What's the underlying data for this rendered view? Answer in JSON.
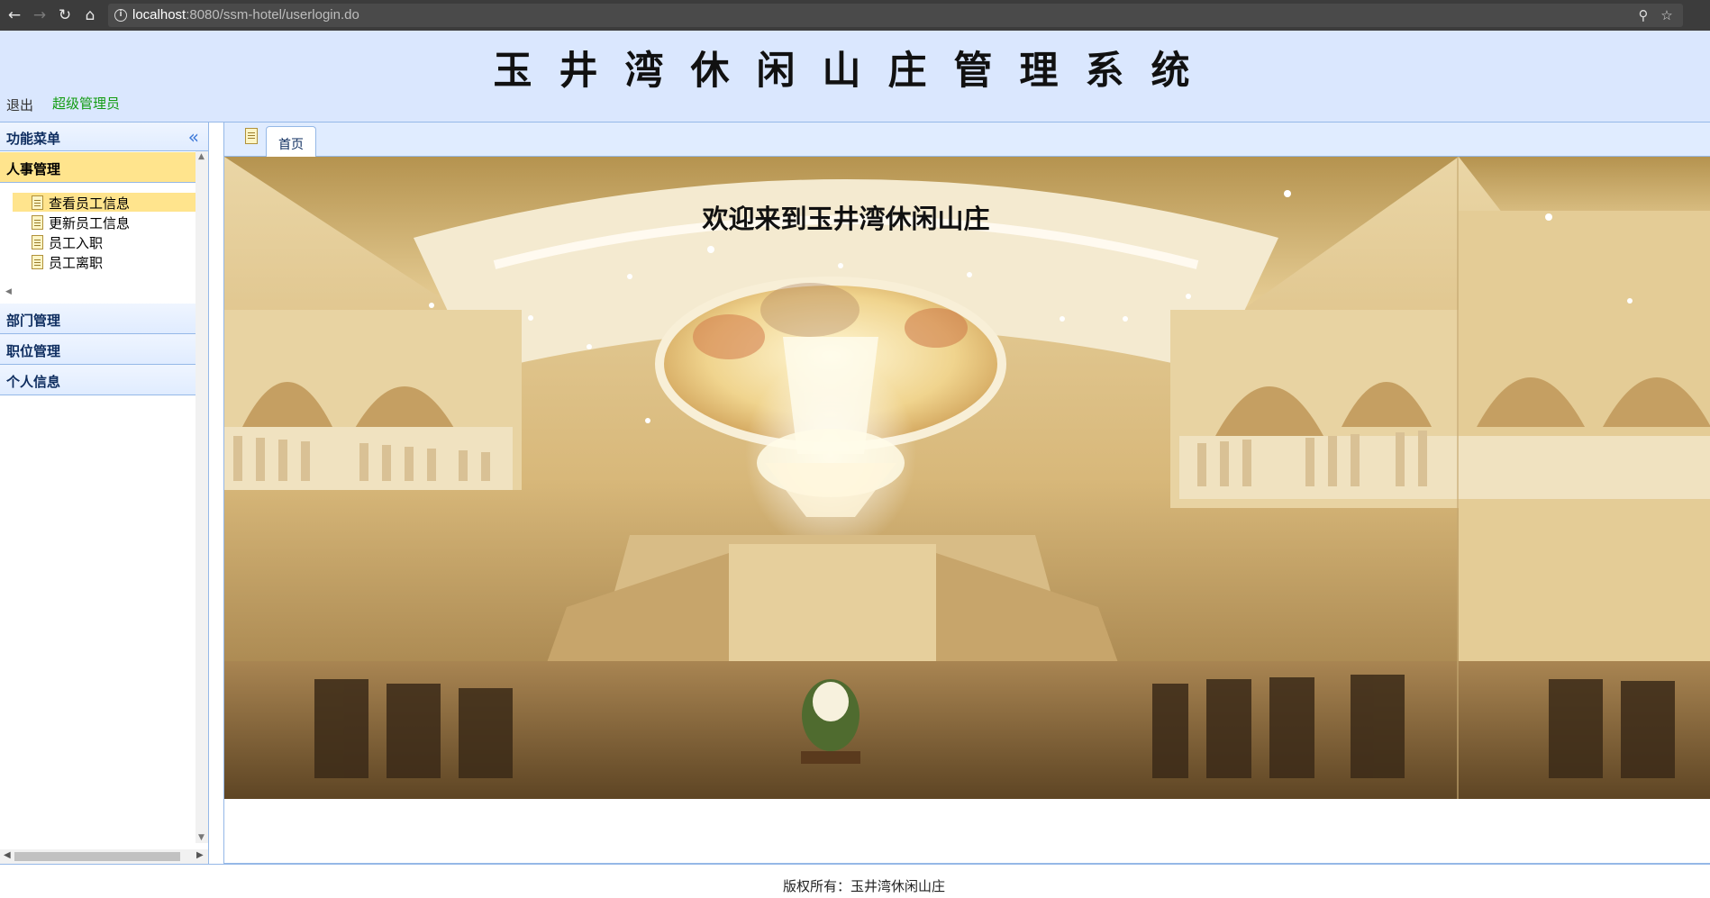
{
  "browser": {
    "url_host": "localhost",
    "url_path": ":8080/ssm-hotel/userlogin.do",
    "icons": [
      "back-icon",
      "forward-icon",
      "reload-icon",
      "home-icon",
      "info-icon",
      "zoom-icon",
      "star-icon"
    ]
  },
  "header": {
    "title": "玉井湾休闲山庄管理系统",
    "logout": "退出",
    "username": "超级管理员"
  },
  "menu": {
    "title": "功能菜单",
    "sections": [
      {
        "label": "人事管理",
        "expanded": true,
        "items": [
          "查看员工信息",
          "更新员工信息",
          "员工入职",
          "员工离职"
        ],
        "selected_item": 0
      },
      {
        "label": "部门管理",
        "expanded": false
      },
      {
        "label": "职位管理",
        "expanded": false
      },
      {
        "label": "个人信息",
        "expanded": false
      }
    ]
  },
  "tabs": [
    {
      "label": "首页",
      "active": true
    }
  ],
  "main": {
    "welcome": "欢迎来到玉井湾休闲山庄"
  },
  "footer": {
    "copyright": "版权所有：玉井湾休闲山庄"
  },
  "colors": {
    "header_bg": "#dae7fe",
    "panel_border": "#95b8e7",
    "selected_bg": "#ffe48d",
    "username_color": "#129c12"
  }
}
